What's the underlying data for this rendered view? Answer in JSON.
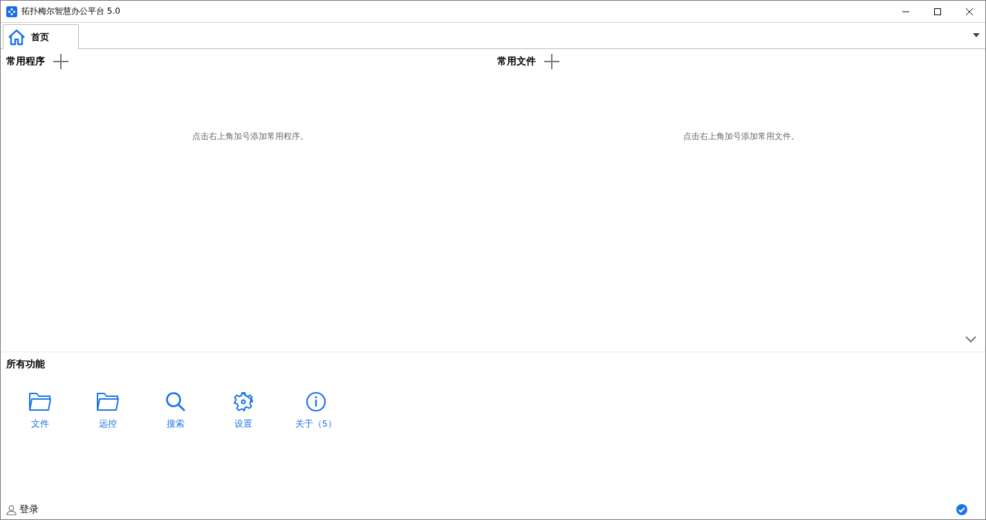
{
  "window": {
    "title": "拓扑梅尔智慧办公平台 5.0"
  },
  "tabs": [
    {
      "label": "首页",
      "selected": true
    }
  ],
  "panels": [
    {
      "title": "常用程序",
      "hint": "点击右上角加号添加常用程序。"
    },
    {
      "title": "常用文件",
      "hint": "点击右上角加号添加常用文件。"
    }
  ],
  "functions": {
    "title": "所有功能",
    "items": [
      {
        "label": "文件",
        "kind": "folder"
      },
      {
        "label": "远控",
        "kind": "folder"
      },
      {
        "label": "搜索",
        "kind": "search"
      },
      {
        "label": "设置",
        "kind": "gear"
      },
      {
        "label": "关于（5）",
        "kind": "info"
      }
    ]
  },
  "status_bar": {
    "login": "登录"
  }
}
